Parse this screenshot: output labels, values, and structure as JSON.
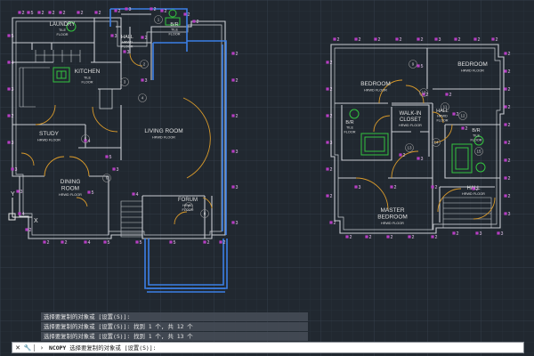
{
  "rooms": {
    "laundry": {
      "name": "LAUNDRY",
      "floor": "TILE\nFLOOR"
    },
    "hall_top": {
      "name": "HALL",
      "floor": "HRWD\nFLOOR"
    },
    "br_top": {
      "name": "B/R",
      "floor": "TILE\nFLOOR"
    },
    "kitchen": {
      "name": "KITCHEN",
      "floor": "TILE\nFLOOR"
    },
    "living": {
      "name": "LIVING ROOM",
      "floor": "HRWD FLOOR"
    },
    "study": {
      "name": "STUDY",
      "floor": "HRWD FLOOR"
    },
    "dining": {
      "name": "DINING\nROOM",
      "floor": "HRWD FLOOR"
    },
    "forum": {
      "name": "FORUM",
      "floor": "HRWD\nFLOOR"
    },
    "bed1": {
      "name": "BEDROOM",
      "floor": "HRWD FLOOR"
    },
    "bed2": {
      "name": "BEDROOM",
      "floor": "HRWD FLOOR"
    },
    "br_left": {
      "name": "B/R",
      "floor": "TILE\nFLOOR"
    },
    "walkin": {
      "name": "WALK-IN\nCLOSET",
      "floor": "HRWD FLOOR"
    },
    "hall_r1": {
      "name": "HALL",
      "floor": "HRWD\nFLOOR"
    },
    "br_right": {
      "name": "B/R",
      "floor": "TILE\nFLOOR"
    },
    "hall_r2": {
      "name": "HALL",
      "floor": "HRWD FLOOR"
    },
    "master": {
      "name": "MASTER\nBEDROOM",
      "floor": "HRWD FLOOR"
    }
  },
  "dimension_labels": {
    "floor1": [
      "2",
      "5",
      "2",
      "2",
      "2",
      "2",
      "2",
      "2",
      "3",
      "2",
      "2",
      "2",
      "2",
      "5",
      "4",
      "3",
      "2",
      "3",
      "3",
      "3",
      "4",
      "2",
      "2",
      "2",
      "4",
      "5",
      "5",
      "5",
      "2",
      "2",
      "2",
      "2",
      "2",
      "3",
      "3",
      "3",
      "3",
      "3",
      "3",
      "4",
      "4",
      "5",
      "5",
      "2",
      "3"
    ],
    "floor2": [
      "2",
      "2",
      "2",
      "2",
      "2",
      "3",
      "2",
      "2",
      "2",
      "2",
      "2",
      "2",
      "2",
      "2",
      "2",
      "2",
      "2",
      "2",
      "3",
      "3",
      "3",
      "2",
      "2",
      "2",
      "2",
      "2",
      "2",
      "2",
      "2",
      "2",
      "3",
      "2",
      "2",
      "2",
      "5",
      "2",
      "2",
      "2",
      "3",
      "2",
      "2",
      "2",
      "2",
      "2",
      "3"
    ]
  },
  "door_tags": [
    "1",
    "2",
    "3",
    "4",
    "5",
    "6",
    "7",
    "8",
    "9",
    "10",
    "11",
    "12",
    "13",
    "14",
    "15"
  ],
  "command_history": [
    "选择要复制的对象或 [设置(S)]:",
    "选择要复制的对象或 [设置(S)]: 找到 1 个, 共 12 个",
    "选择要复制的对象或 [设置(S)]: 找到 1 个, 共 13 个"
  ],
  "command_line": {
    "command": "NCOPY",
    "prompt": "选择要复制的对象或 [设置(S)]:"
  },
  "ucs": {
    "y": "Y",
    "x": "X"
  },
  "colors": {
    "background": "#212830",
    "grid": "#2c3540",
    "walls": "#c9cdd2",
    "selected_walls": "#3b7fe6",
    "dimensions": "#b73ec4",
    "arcs": "#d99a2b",
    "fixtures": "#33c43f",
    "text": "#e0e0e0"
  }
}
